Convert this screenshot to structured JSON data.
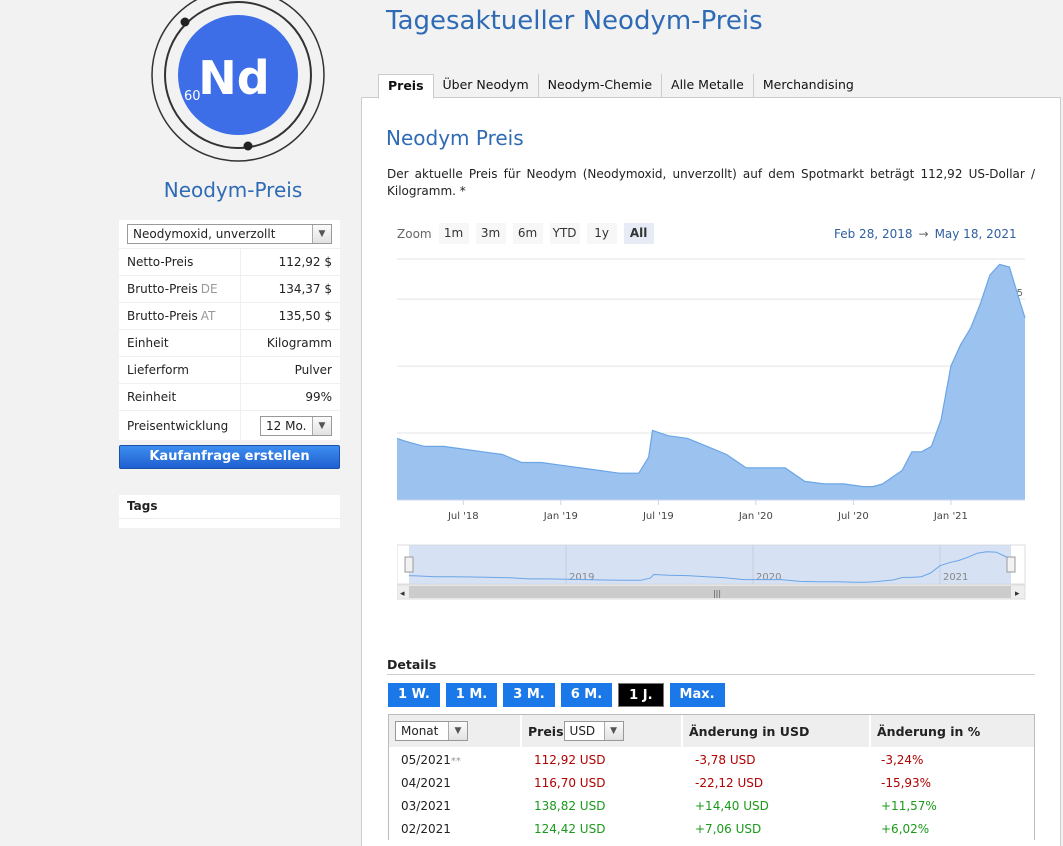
{
  "element": {
    "symbol": "Nd",
    "atomic_number": "60"
  },
  "sidebar": {
    "title": "Neodym-Preis",
    "product_select": "Neodymoxid, unverzollt",
    "rows": [
      {
        "label": "Netto-Preis",
        "suffix": "",
        "value": "112,92 $"
      },
      {
        "label": "Brutto-Preis",
        "suffix": "DE",
        "value": "134,37 $"
      },
      {
        "label": "Brutto-Preis",
        "suffix": "AT",
        "value": "135,50 $"
      },
      {
        "label": "Einheit",
        "suffix": "",
        "value": "Kilogramm"
      },
      {
        "label": "Lieferform",
        "suffix": "",
        "value": "Pulver"
      },
      {
        "label": "Reinheit",
        "suffix": "",
        "value": "99%"
      }
    ],
    "trend_label": "Preisentwicklung",
    "trend_select": "12 Mo.",
    "buy_button": "Kaufanfrage erstellen",
    "tags_title": "Tags"
  },
  "page_title": "Tagesaktueller Neodym-Preis",
  "tabs": [
    "Preis",
    "Über Neodym",
    "Neodym-Chemie",
    "Alle Metalle",
    "Merchandising"
  ],
  "section_title": "Neodym Preis",
  "description": "Der aktuelle Preis für Neodym (Neodymoxid, unverzollt) auf dem Spotmarkt beträgt 112,92 US-Dollar / Kilogramm. *",
  "zoom": {
    "label": "Zoom",
    "buttons": [
      "1m",
      "3m",
      "6m",
      "YTD",
      "1y",
      "All"
    ],
    "active": "All"
  },
  "date_range": {
    "from": "Feb 28, 2018",
    "arrow": "→",
    "to": "May 18, 2021"
  },
  "chart_data": {
    "type": "area",
    "x": [
      2018.16,
      2018.2,
      2018.3,
      2018.4,
      2018.5,
      2018.6,
      2018.7,
      2018.8,
      2018.9,
      2019.0,
      2019.1,
      2019.2,
      2019.3,
      2019.4,
      2019.45,
      2019.47,
      2019.55,
      2019.65,
      2019.75,
      2019.85,
      2019.95,
      2020.05,
      2020.15,
      2020.25,
      2020.35,
      2020.45,
      2020.55,
      2020.6,
      2020.65,
      2020.75,
      2020.8,
      2020.85,
      2020.9,
      2020.95,
      2021.0,
      2021.05,
      2021.1,
      2021.15,
      2021.2,
      2021.25,
      2021.3,
      2021.35,
      2021.38
    ],
    "values": [
      73,
      72,
      70,
      70,
      69,
      68,
      67,
      64,
      64,
      63,
      62,
      61,
      60,
      60,
      66,
      76,
      74,
      73,
      70,
      67,
      62,
      62,
      62,
      57,
      56,
      56,
      55,
      55,
      56,
      61,
      68,
      68,
      70,
      80,
      100,
      108,
      114,
      123,
      134,
      138,
      137,
      125,
      118
    ],
    "xlim": [
      2018.16,
      2021.38
    ],
    "ylim": [
      50,
      140
    ],
    "y_ticks": [
      50,
      75,
      100,
      125
    ],
    "x_ticks": [
      {
        "x": 2018.5,
        "label": "Jul '18"
      },
      {
        "x": 2019.0,
        "label": "Jan '19"
      },
      {
        "x": 2019.5,
        "label": "Jul '19"
      },
      {
        "x": 2020.0,
        "label": "Jan '20"
      },
      {
        "x": 2020.5,
        "label": "Jul '20"
      },
      {
        "x": 2021.0,
        "label": "Jan '21"
      }
    ],
    "navigator_ticks": [
      {
        "x": 2019.0,
        "label": "2019"
      },
      {
        "x": 2020.0,
        "label": "2020"
      },
      {
        "x": 2021.0,
        "label": "2021"
      }
    ],
    "grid": true,
    "area_color": "#9cc3ef",
    "line_color": "#6aa5e6"
  },
  "details": {
    "title": "Details",
    "period_buttons": [
      "1 W.",
      "1 M.",
      "3 M.",
      "6 M.",
      "1 J.",
      "Max."
    ],
    "active_period": "1 J.",
    "headers": {
      "period_select": "Monat",
      "price": "Preis",
      "currency_select": "USD",
      "change_usd": "Änderung in USD",
      "change_pct": "Änderung in %"
    },
    "rows": [
      {
        "month": "05/2021",
        "mark": "**",
        "price": "112,92 USD",
        "change": "-3,78 USD",
        "pct": "-3,24%",
        "dir": "neg"
      },
      {
        "month": "04/2021",
        "mark": "",
        "price": "116,70 USD",
        "change": "-22,12 USD",
        "pct": "-15,93%",
        "dir": "neg"
      },
      {
        "month": "03/2021",
        "mark": "",
        "price": "138,82 USD",
        "change": "+14,40 USD",
        "pct": "+11,57%",
        "dir": "pos"
      },
      {
        "month": "02/2021",
        "mark": "",
        "price": "124,42 USD",
        "change": "+7,06 USD",
        "pct": "+6,02%",
        "dir": "pos"
      }
    ]
  }
}
